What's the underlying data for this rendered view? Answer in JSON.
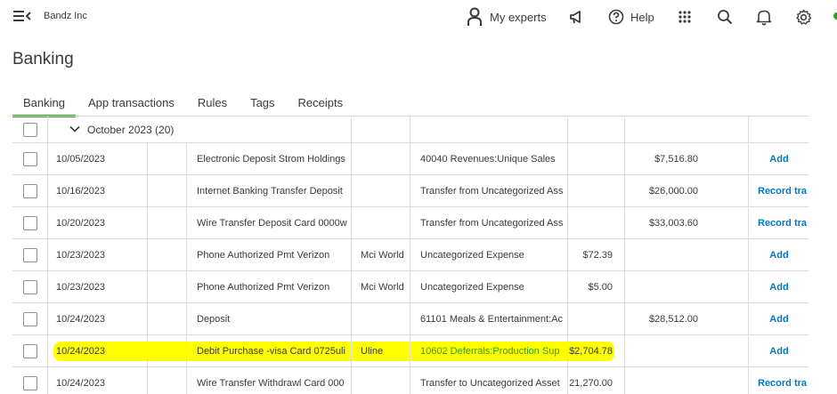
{
  "header": {
    "company": "Bandz Inc",
    "my_experts": "My experts",
    "help": "Help",
    "icons": [
      "menu-icon",
      "person-icon",
      "megaphone-icon",
      "help-icon",
      "apps-grid-icon",
      "search-icon",
      "bell-icon",
      "gear-icon"
    ]
  },
  "page": {
    "title": "Banking"
  },
  "tabs": [
    {
      "label": "Banking",
      "active": true
    },
    {
      "label": "App transactions",
      "active": false
    },
    {
      "label": "Rules",
      "active": false
    },
    {
      "label": "Tags",
      "active": false
    },
    {
      "label": "Receipts",
      "active": false
    }
  ],
  "group": {
    "label": "October 2023 (20)"
  },
  "rows": [
    {
      "date": "10/05/2023",
      "description": "Electronic Deposit Strom Holdings",
      "payee": "",
      "category": "40040 Revenues:Unique Sales",
      "spent": "",
      "received": "$7,516.80",
      "action": "Add"
    },
    {
      "date": "10/16/2023",
      "description": "Internet Banking Transfer Deposit",
      "payee": "",
      "category": "Transfer from Uncategorized Ass",
      "spent": "",
      "received": "$26,000.00",
      "action": "Record tra"
    },
    {
      "date": "10/20/2023",
      "description": "Wire Transfer Deposit Card 0000w",
      "payee": "",
      "category": "Transfer from Uncategorized Ass",
      "spent": "",
      "received": "$33,003.60",
      "action": "Record tra"
    },
    {
      "date": "10/23/2023",
      "description": "Phone Authorized Pmt Verizon",
      "payee": "Mci World",
      "category": "Uncategorized Expense",
      "spent": "$72.39",
      "received": "",
      "action": "Add"
    },
    {
      "date": "10/23/2023",
      "description": "Phone Authorized Pmt Verizon",
      "payee": "Mci World",
      "category": "Uncategorized Expense",
      "spent": "$5.00",
      "received": "",
      "action": "Add"
    },
    {
      "date": "10/24/2023",
      "description": "Deposit",
      "payee": "",
      "category": "61101 Meals & Entertainment:Ac",
      "spent": "",
      "received": "$28,512.00",
      "action": "Add"
    },
    {
      "date": "10/24/2023",
      "description": "Debit Purchase -visa Card 0725uli",
      "payee": "Uline",
      "category": "10602 Deferrals:Production Sup",
      "spent": "$2,704.78",
      "received": "",
      "action": "Add",
      "highlighted": true
    },
    {
      "date": "10/24/2023",
      "description": "Wire Transfer Withdrawl Card 000",
      "payee": "",
      "category": "Transfer to Uncategorized Asset",
      "spent": "21,270.00",
      "received": "",
      "action": "Record tra"
    }
  ],
  "colors": {
    "accent": "#2ca01c",
    "link": "#0077c5",
    "highlight": "#ffff00",
    "text": "#393a3d"
  }
}
